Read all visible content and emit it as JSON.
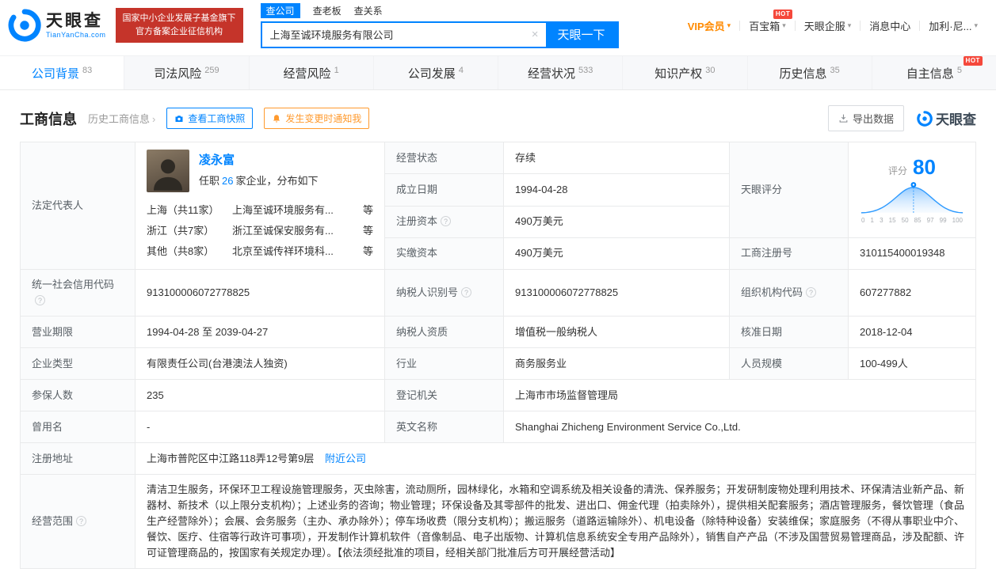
{
  "accent_color": "#0084ff",
  "brand_red": "#c5342a",
  "header": {
    "brand": "天眼查",
    "brand_sub": "TianYanCha.com",
    "gov_badge_line1": "国家中小企业发展子基金旗下",
    "gov_badge_line2": "官方备案企业征信机构",
    "search_tabs": [
      {
        "label": "查公司"
      },
      {
        "label": "查老板"
      },
      {
        "label": "查关系"
      }
    ],
    "search_value": "上海至诚环境服务有限公司",
    "search_button": "天眼一下",
    "vip": "VIP会员",
    "treasure": "百宝箱",
    "enterprise": "天眼企服",
    "messages": "消息中心",
    "username": "加利·尼...",
    "hot": "HOT"
  },
  "nav": {
    "hot": "HOT",
    "tabs": [
      {
        "label": "公司背景",
        "count": "83"
      },
      {
        "label": "司法风险",
        "count": "259"
      },
      {
        "label": "经营风险",
        "count": "1"
      },
      {
        "label": "公司发展",
        "count": "4"
      },
      {
        "label": "经营状况",
        "count": "533"
      },
      {
        "label": "知识产权",
        "count": "30"
      },
      {
        "label": "历史信息",
        "count": "35"
      },
      {
        "label": "自主信息",
        "count": "5"
      }
    ]
  },
  "section": {
    "title": "工商信息",
    "history_link": "历史工商信息",
    "snapshot_btn": "查看工商快照",
    "notify_btn": "发生变更时通知我",
    "export_btn": "导出数据",
    "brand_watermark": "天眼查"
  },
  "legal_rep": {
    "label": "法定代表人",
    "name": "凌永富",
    "tenure_prefix": "任职",
    "tenure_count": "26",
    "tenure_suffix": "家企业，分布如下",
    "distribution": [
      {
        "region": "上海（共11家）",
        "company": "上海至诚环境服务有...",
        "etc": "等"
      },
      {
        "region": "浙江（共7家）",
        "company": "浙江至诚保安服务有...",
        "etc": "等"
      },
      {
        "region": "其他（共8家）",
        "company": "北京至诚传祥环境科...",
        "etc": "等"
      }
    ]
  },
  "score": {
    "label": "天眼评分",
    "caption": "评分",
    "value": "80",
    "axis_ticks": [
      "0",
      "1",
      "3",
      "15",
      "50",
      "85",
      "97",
      "99",
      "100"
    ]
  },
  "info": {
    "status_label": "经营状态",
    "status": "存续",
    "established_label": "成立日期",
    "established": "1994-04-28",
    "reg_capital_label": "注册资本",
    "reg_capital": "490万美元",
    "paid_capital_label": "实缴资本",
    "paid_capital": "490万美元",
    "reg_no_label": "工商注册号",
    "reg_no": "310115400019348",
    "credit_code_label": "统一社会信用代码",
    "credit_code": "913100006072778825",
    "tax_id_label": "纳税人识别号",
    "tax_id": "913100006072778825",
    "org_code_label": "组织机构代码",
    "org_code": "607277882",
    "term_label": "营业期限",
    "term": "1994-04-28  至  2039-04-27",
    "tax_quality_label": "纳税人资质",
    "tax_quality": "增值税一般纳税人",
    "approved_label": "核准日期",
    "approved": "2018-12-04",
    "type_label": "企业类型",
    "type": "有限责任公司(台港澳法人独资)",
    "industry_label": "行业",
    "industry": "商务服务业",
    "staff_label": "人员规模",
    "staff": "100-499人",
    "insured_label": "参保人数",
    "insured": "235",
    "authority_label": "登记机关",
    "authority": "上海市市场监督管理局",
    "former_label": "曾用名",
    "former": "-",
    "en_name_label": "英文名称",
    "en_name": "Shanghai Zhicheng Environment Service Co.,Ltd.",
    "address_label": "注册地址",
    "address": "上海市普陀区中江路118弄12号第9层",
    "nearby": "附近公司",
    "scope_label": "经营范围",
    "scope": "清洁卫生服务，环保环卫工程设施管理服务，灭虫除害，流动厕所，园林绿化，水箱和空调系统及相关设备的清洗、保养服务；开发研制废物处理利用技术、环保清洁业新产品、新器材、新技术（以上限分支机构）；上述业务的咨询；物业管理；环保设备及其零部件的批发、进出口、佣金代理（拍卖除外），提供相关配套服务；酒店管理服务，餐饮管理（食品生产经营除外）；会展、会务服务（主办、承办除外）；停车场收费（限分支机构）；搬运服务（道路运输除外）、机电设备（除特种设备）安装维保；家庭服务（不得从事职业中介、餐饮、医疗、住宿等行政许可事项），开发制作计算机软件（音像制品、电子出版物、计算机信息系统安全专用产品除外），销售自产产品（不涉及国营贸易管理商品，涉及配额、许可证管理商品的，按国家有关规定办理）。【依法须经批准的项目，经相关部门批准后方可开展经营活动】"
  }
}
